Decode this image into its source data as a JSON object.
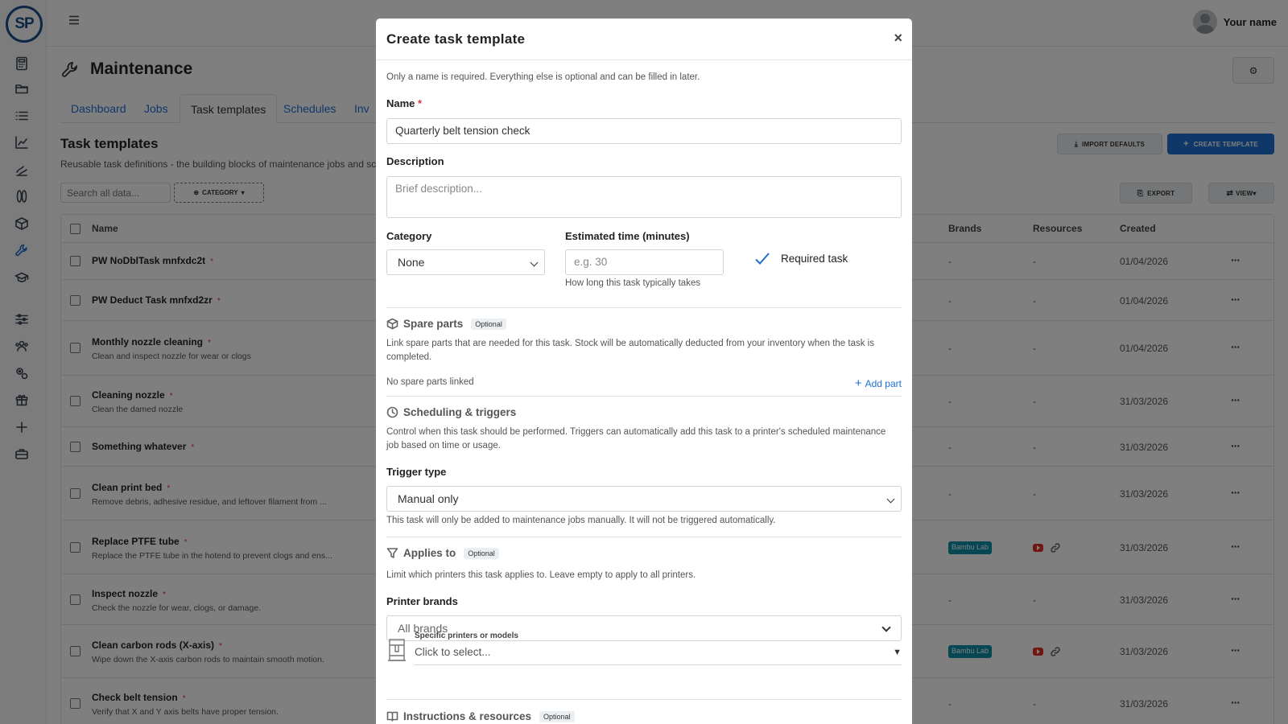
{
  "app": {
    "logo_text": "SP",
    "user_name": "Your name"
  },
  "sidebar": {
    "items": [
      {
        "icon": "calculator-icon"
      },
      {
        "icon": "folder-icon"
      },
      {
        "icon": "list-icon"
      },
      {
        "icon": "chart-line-icon"
      },
      {
        "icon": "filament-icon"
      },
      {
        "icon": "spool-icon"
      },
      {
        "icon": "box-icon"
      },
      {
        "icon": "wrench-icon"
      },
      {
        "icon": "graduation-cap-icon"
      },
      {
        "icon": "sliders-icon"
      },
      {
        "icon": "users-icon"
      },
      {
        "icon": "gears-icon"
      },
      {
        "icon": "gift-icon"
      },
      {
        "icon": "plus-icon"
      },
      {
        "icon": "briefcase-icon"
      }
    ]
  },
  "page": {
    "title": "Maintenance",
    "gear_button": "⚙"
  },
  "tabs": [
    {
      "label": "Dashboard"
    },
    {
      "label": "Jobs"
    },
    {
      "label": "Task templates"
    },
    {
      "label": "Schedules"
    },
    {
      "label": "Inv"
    }
  ],
  "section": {
    "title": "Task templates",
    "subtitle": "Reusable task definitions - the building blocks of maintenance jobs and sche",
    "import_defaults": "IMPORT DEFAULTS",
    "create_template": "CREATE TEMPLATE",
    "export": "EXPORT",
    "view": "VIEW",
    "search_placeholder": "Search all data...",
    "category_filter": "CATEGORY"
  },
  "table": {
    "columns": {
      "name": "Name",
      "brands": "Brands",
      "resources": "Resources",
      "created": "Created"
    },
    "rows": [
      {
        "name": "PW NoDblTask mnfxdc2t",
        "desc": "",
        "brands": "-",
        "resources": "-",
        "created": "01/04/2026"
      },
      {
        "name": "PW Deduct Task mnfxd2zr",
        "desc": "",
        "brands": "-",
        "resources": "-",
        "created": "01/04/2026"
      },
      {
        "name": "Monthly nozzle cleaning",
        "desc": "Clean and inspect nozzle for wear or clogs",
        "brands": "-",
        "resources": "-",
        "created": "01/04/2026"
      },
      {
        "name": "Cleaning nozzle",
        "desc": "Clean the damed nozzle",
        "brands": "-",
        "resources": "-",
        "created": "31/03/2026"
      },
      {
        "name": "Something whatever",
        "desc": "",
        "brands": "-",
        "resources": "-",
        "created": "31/03/2026"
      },
      {
        "name": "Clean print bed",
        "desc": "Remove debris, adhesive residue, and leftover filament from ...",
        "brands": "-",
        "resources": "-",
        "created": "31/03/2026"
      },
      {
        "name": "Replace PTFE tube",
        "desc": "Replace the PTFE tube in the hotend to prevent clogs and ens...",
        "brands": "Bambu Lab",
        "resources": "",
        "created": "31/03/2026"
      },
      {
        "name": "Inspect nozzle",
        "desc": "Check the nozzle for wear, clogs, or damage.",
        "brands": "-",
        "resources": "-",
        "created": "31/03/2026"
      },
      {
        "name": "Clean carbon rods (X-axis)",
        "desc": "Wipe down the X-axis carbon rods to maintain smooth motion.",
        "brands": "Bambu Lab",
        "resources": "",
        "created": "31/03/2026"
      },
      {
        "name": "Check belt tension",
        "desc": "Verify that X and Y axis belts have proper tension.",
        "brands": "-",
        "resources": "-",
        "created": "31/03/2026"
      }
    ],
    "row_menu": "···",
    "required_mark": "*"
  },
  "modal": {
    "title": "Create task template",
    "close": "×",
    "intro": "Only a name is required. Everything else is optional and can be filled in later.",
    "name_label": "Name",
    "required_star": "*",
    "name_value": "Quarterly belt tension check",
    "description_label": "Description",
    "description_placeholder": "Brief description...",
    "category_label": "Category",
    "category_value": "None",
    "est_label": "Estimated time (minutes)",
    "est_placeholder": "e.g. 30",
    "est_help": "How long this task typically takes",
    "required_task": "Required task",
    "spare_parts": {
      "title": "Spare parts",
      "optional": "Optional",
      "desc": "Link spare parts that are needed for this task. Stock will be automatically deducted from your inventory when the task is completed.",
      "none": "No spare parts linked",
      "add": "Add part"
    },
    "scheduling": {
      "title": "Scheduling & triggers",
      "desc": "Control when this task should be performed. Triggers can automatically add this task to a printer's scheduled maintenance job based on time or usage.",
      "trigger_label": "Trigger type",
      "trigger_value": "Manual only",
      "trigger_help": "This task will only be added to maintenance jobs manually. It will not be triggered automatically."
    },
    "applies": {
      "title": "Applies to",
      "optional": "Optional",
      "desc": "Limit which printers this task applies to. Leave empty to apply to all printers.",
      "brands_label": "Printer brands",
      "brands_value": "All brands",
      "specific_label": "Specific printers or models",
      "specific_placeholder": "Click to select..."
    },
    "instructions": {
      "title": "Instructions & resources",
      "optional": "Optional"
    }
  }
}
